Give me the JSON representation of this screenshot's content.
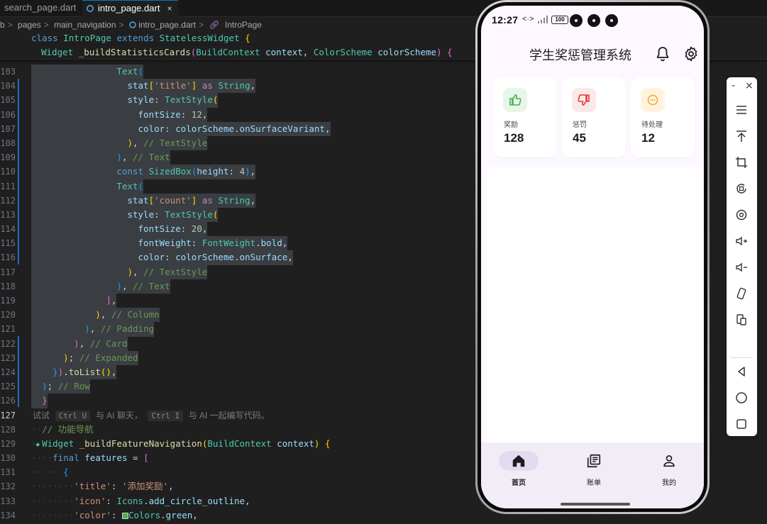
{
  "editor": {
    "tabs": [
      {
        "label": "search_page.dart",
        "active": false
      },
      {
        "label": "intro_page.dart",
        "active": true,
        "close": "×"
      }
    ],
    "breadcrumb": [
      "b",
      "pages",
      "main_navigation",
      "intro_page.dart",
      "IntroPage"
    ],
    "breadcrumb_sep": ">",
    "sticky": [
      {
        "kw": "class",
        "name": "IntroPage",
        "kw2": "extends",
        "base": "StatelessWidget",
        "rest": " {"
      },
      {
        "type": "Widget",
        "fn": "_buildStatisticsCards",
        "p1t": "BuildContext",
        "p1": "context",
        "p2t": "ColorScheme",
        "p2": "colorScheme",
        "rest": ") {"
      }
    ],
    "line_numbers": [
      "103",
      "104",
      "105",
      "106",
      "107",
      "108",
      "109",
      "110",
      "111",
      "112",
      "113",
      "114",
      "115",
      "116",
      "117",
      "118",
      "119",
      "120",
      "121",
      "122",
      "123",
      "124",
      "125",
      "126",
      "127",
      "128",
      "129",
      "130",
      "131",
      "132",
      "133",
      "134"
    ],
    "ai_hint": {
      "pre": "试试",
      "k1": "Ctrl U",
      "mid": "与 AI 聊天，",
      "k2": "Ctrl I",
      "post": "与 AI 一起编写代码。"
    },
    "code": {
      "text": "Text",
      "stat": "stat",
      "title_key": "'title'",
      "as": "as",
      "String": "String",
      "style": "style",
      "TextStyle": "TextStyle",
      "fontSize": "fontSize",
      "n12": "12",
      "color": "color",
      "colorScheme": "colorScheme",
      "onSurfaceVariant": "onSurfaceVariant",
      "c_TextStyle": "// TextStyle",
      "c_Text": "// Text",
      "const": "const",
      "SizedBox": "SizedBox",
      "height": "height",
      "n4": "4",
      "count_key": "'count'",
      "n20": "20",
      "fontWeight": "fontWeight",
      "FontWeight": "FontWeight",
      "bold": "bold",
      "onSurface": "onSurface",
      "c_Column": "// Column",
      "c_Padding": "// Padding",
      "c_Card": "// Card",
      "c_Expanded": "// Expanded",
      "toList": "toList",
      "c_Row": "// Row",
      "c_nav": "// 功能导航",
      "Widget": "Widget",
      "buildFeatureNavigation": "_buildFeatureNavigation",
      "BuildContext": "BuildContext",
      "context": "context",
      "final": "final",
      "features": "features",
      "title_key2": "'title'",
      "title_val": "'添加奖励'",
      "icon_key": "'icon'",
      "Icons": "Icons",
      "add_circle_outline": "add_circle_outline",
      "color_key": "'color'",
      "Colors": "Colors",
      "green": "green"
    }
  },
  "phone": {
    "status": {
      "time": "12:27",
      "battery": "100"
    },
    "app_title": "学生奖惩管理系统",
    "stats": [
      {
        "label": "奖励",
        "count": "128",
        "color": "#4caf50",
        "bg": "#e8f5e9",
        "icon": "thumb-up-icon"
      },
      {
        "label": "惩罚",
        "count": "45",
        "color": "#e53935",
        "bg": "#fde8e8",
        "icon": "thumb-down-icon"
      },
      {
        "label": "待处理",
        "count": "12",
        "color": "#f5a623",
        "bg": "#fff3e0",
        "icon": "pending-icon"
      }
    ],
    "nav": [
      {
        "label": "首页",
        "icon": "home-icon",
        "active": true
      },
      {
        "label": "账单",
        "icon": "ledger-icon",
        "active": false
      },
      {
        "label": "我的",
        "icon": "person-icon",
        "active": false
      }
    ],
    "accent": "#e3dcf1"
  },
  "toolbar": {
    "minimize": "-",
    "close": "×",
    "buttons": [
      "menu-icon",
      "pin-top-icon",
      "crop-icon",
      "rotate-icon",
      "screenshot-icon",
      "volume-up-icon",
      "volume-down-icon",
      "rotate-device-icon",
      "multi-device-icon",
      "back-icon",
      "home-circle-icon",
      "recent-apps-icon"
    ]
  }
}
